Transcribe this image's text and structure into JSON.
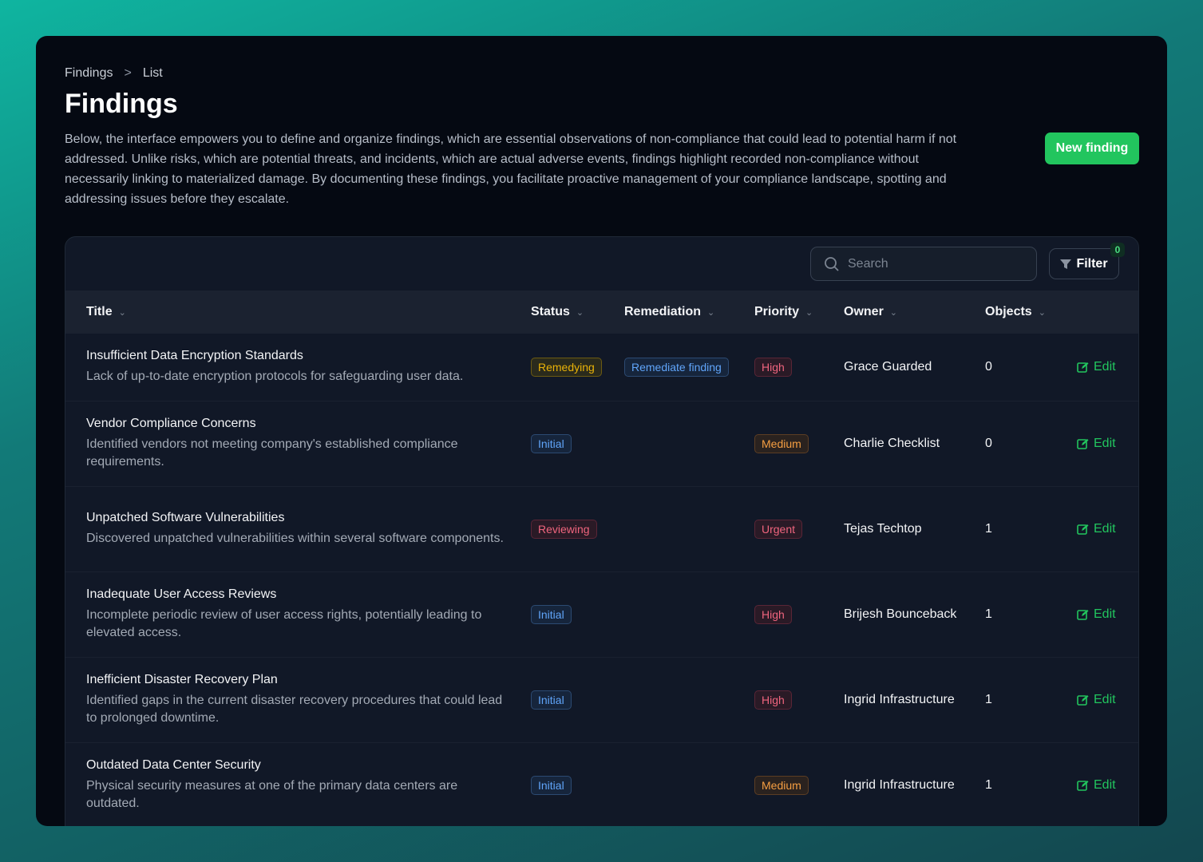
{
  "breadcrumb": [
    "Findings",
    "List"
  ],
  "title": "Findings",
  "description": "Below, the interface empowers you to define and organize findings, which are essential observations of non-compliance that could lead to potential harm if not addressed. Unlike risks, which are potential threats, and incidents, which are actual adverse events, findings highlight recorded non-compliance without necessarily linking to materialized damage. By documenting these findings, you facilitate proactive management of your compliance landscape, spotting and addressing issues before they escalate.",
  "new_button": "New finding",
  "search": {
    "placeholder": "Search"
  },
  "filter": {
    "label": "Filter",
    "count": "0"
  },
  "columns": [
    "Title",
    "Status",
    "Remediation",
    "Priority",
    "Owner",
    "Objects"
  ],
  "edit_label": "Edit",
  "rows": [
    {
      "title": "Insufficient Data Encryption Standards",
      "desc": "Lack of up-to-date encryption protocols for safeguarding user data.",
      "status": "Remedying",
      "status_color": "yellow",
      "remediation": "Remediate finding",
      "priority": "High",
      "priority_color": "red",
      "owner": "Grace Guarded",
      "objects": "0"
    },
    {
      "title": "Vendor Compliance Concerns",
      "desc": "Identified vendors not meeting company's established compliance requirements.",
      "status": "Initial",
      "status_color": "blue",
      "remediation": "",
      "priority": "Medium",
      "priority_color": "orange",
      "owner": "Charlie Checklist",
      "objects": "0"
    },
    {
      "title": "Unpatched Software Vulnerabilities",
      "desc": "Discovered unpatched vulnerabilities within several software components.",
      "status": "Reviewing",
      "status_color": "red",
      "remediation": "",
      "priority": "Urgent",
      "priority_color": "red",
      "owner": "Tejas Techtop",
      "objects": "1"
    },
    {
      "title": "Inadequate User Access Reviews",
      "desc": "Incomplete periodic review of user access rights, potentially leading to elevated access.",
      "status": "Initial",
      "status_color": "blue",
      "remediation": "",
      "priority": "High",
      "priority_color": "red",
      "owner": "Brijesh Bounceback",
      "objects": "1"
    },
    {
      "title": "Inefficient Disaster Recovery Plan",
      "desc": "Identified gaps in the current disaster recovery procedures that could lead to prolonged downtime.",
      "status": "Initial",
      "status_color": "blue",
      "remediation": "",
      "priority": "High",
      "priority_color": "red",
      "owner": "Ingrid Infrastructure",
      "objects": "1"
    },
    {
      "title": "Outdated Data Center Security",
      "desc": "Physical security measures at one of the primary data centers are outdated.",
      "status": "Initial",
      "status_color": "blue",
      "remediation": "",
      "priority": "Medium",
      "priority_color": "orange",
      "owner": "Ingrid Infrastructure",
      "objects": "1"
    }
  ]
}
